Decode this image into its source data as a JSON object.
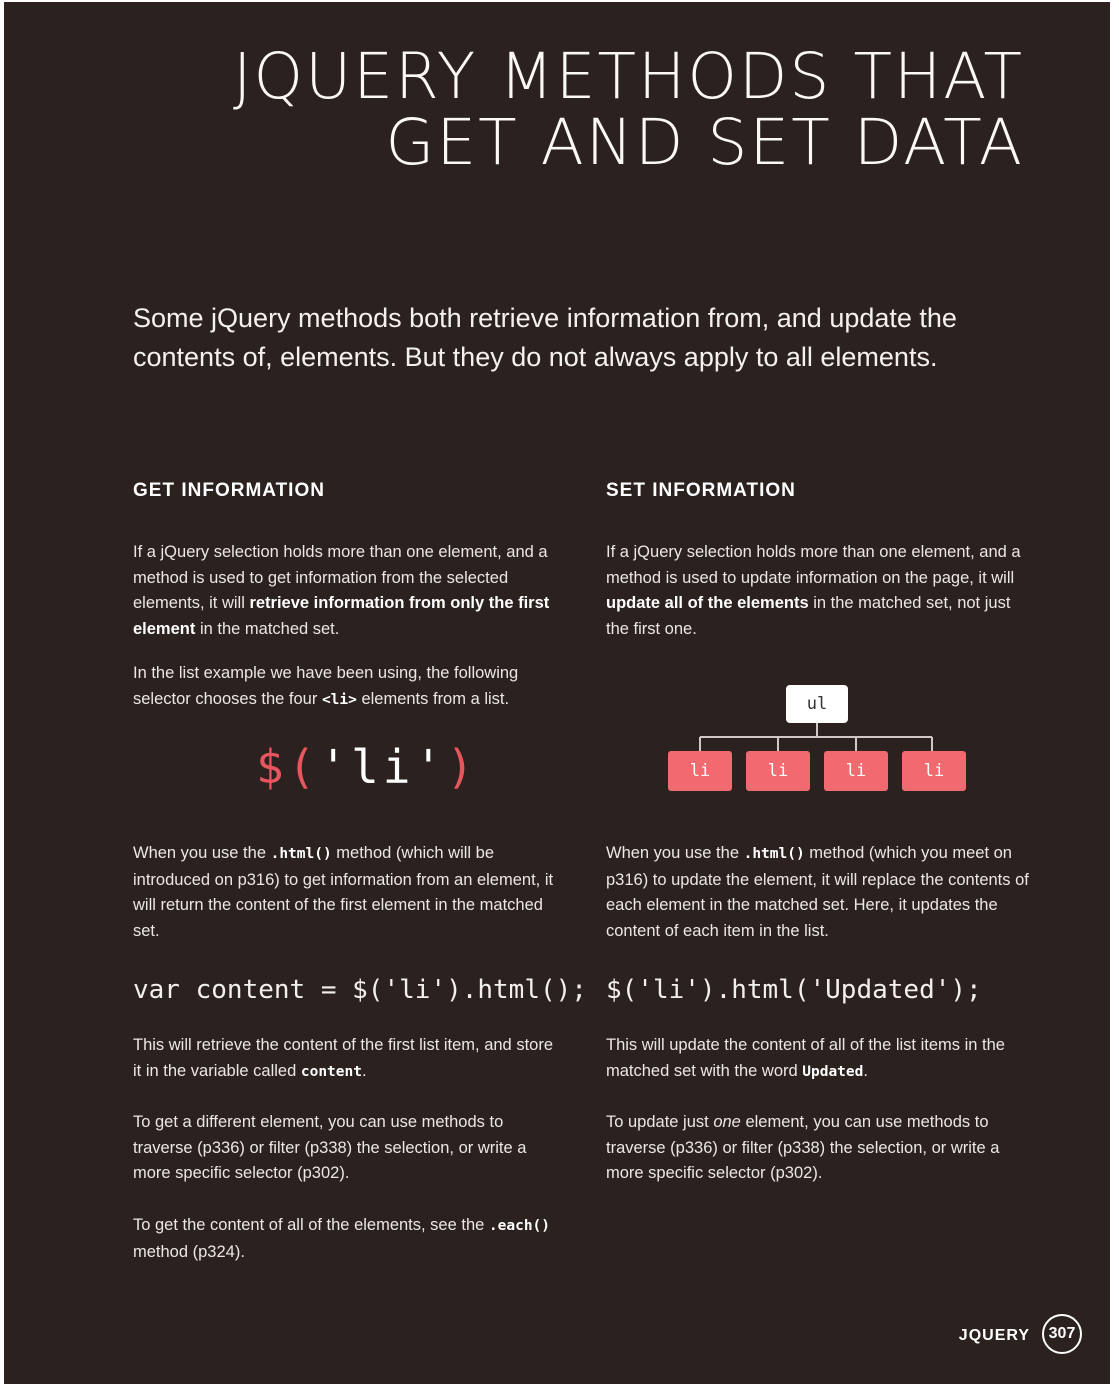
{
  "title": {
    "line1": "JQUERY METHODS THAT",
    "line2": "GET AND SET DATA"
  },
  "intro": "Some jQuery methods both retrieve information from, and update the contents of, elements.  But they do not always apply to all elements.",
  "get": {
    "heading": "GET INFORMATION",
    "p1": {
      "a": "If a jQuery selection holds more than one element, and a method is used to get information from the selected elements, it will ",
      "b": "retrieve information from only the first element",
      "c": " in the matched set."
    },
    "p2": {
      "a": "In the list example we have been using, the following selector chooses the four ",
      "code": "<li>",
      "b": " elements from a list."
    },
    "selector": {
      "dollar": "$",
      "open": "(",
      "str": "'li'",
      "close": ")"
    },
    "p3": {
      "a": "When you use the ",
      "code": ".html()",
      "b": " method (which will be introduced on p316) to get information from an element, it will return the content of the first element in the matched set."
    },
    "code": "var content = $('li').html();",
    "p4": {
      "a": "This will retrieve the content of the first list item, and store it in the variable called ",
      "code": "content",
      "b": "."
    },
    "p5": "To get a different element, you can use methods to traverse (p336) or filter (p338) the selection, or write a more specific selector (p302).",
    "p6": {
      "a": "To get the content of all of the elements, see the ",
      "code": ".each()",
      "b": " method (p324)."
    }
  },
  "set": {
    "heading": "SET INFORMATION",
    "p1": {
      "a": "If a jQuery selection holds more than one element, and a method is used to update information on the page, it will ",
      "b": "update all of the elements",
      "c": " in the matched set, not just the first one."
    },
    "diagram": {
      "parent": "ul",
      "children": [
        "li",
        "li",
        "li",
        "li"
      ]
    },
    "p3": {
      "a": "When you use the ",
      "code": ".html()",
      "b": " method (which you meet on p316) to update the element, it will replace the contents of each element in the matched set. Here, it updates the content of each item in the list."
    },
    "code": "$('li').html('Updated');",
    "p4": {
      "a": "This will update the content of all of the list items in the matched set with the word ",
      "code": "Updated",
      "b": "."
    },
    "p5": {
      "a": "To update just ",
      "em": "one",
      "b": " element, you can use methods to traverse (p336) or filter (p338) the selection, or write a more specific selector (p302)."
    }
  },
  "footer": {
    "label": "JQUERY",
    "page": "307"
  },
  "colors": {
    "background": "#2b2220",
    "accent": "#e7565f",
    "node": "#f06a6f"
  }
}
